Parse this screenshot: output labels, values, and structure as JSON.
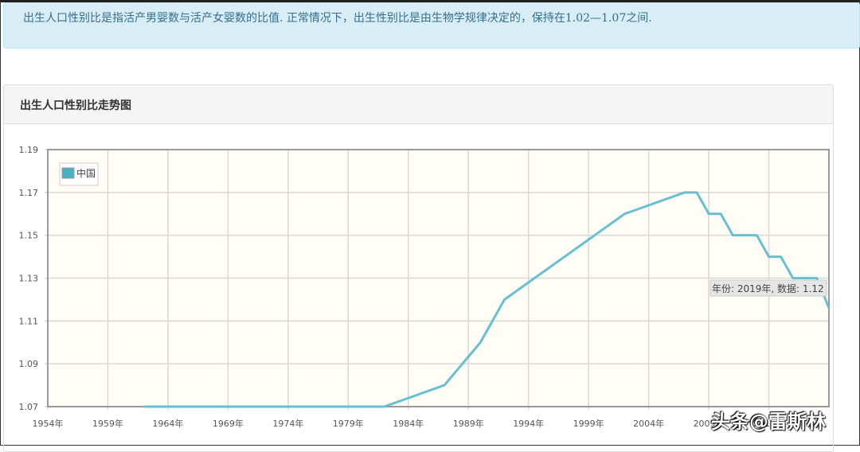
{
  "alert_text": "出生人口性别比是指活产男婴数与活产女婴数的比值. 正常情况下，出生性别比是由生物学规律决定的，保持在1.02—1.07之间.",
  "panel_title": "出生人口性别比走势图",
  "watermark": "头条@雷斯林",
  "tooltip": "年份: 2019年, 数据: 1.12",
  "colors": {
    "line": "#68bfcf",
    "plot_bg": "#fffdf6",
    "grid": "#d8d8d8"
  },
  "chart_data": {
    "type": "line",
    "title": "出生人口性别比走势图",
    "xlim": [
      1954,
      2019
    ],
    "ylim": [
      1.07,
      1.19
    ],
    "x_ticks": [
      1954,
      1959,
      1964,
      1969,
      1974,
      1979,
      1984,
      1989,
      1994,
      1999,
      2004,
      2009,
      2014
    ],
    "x_tick_labels": [
      "1954年",
      "1959年",
      "1964年",
      "1969年",
      "1974年",
      "1979年",
      "1984年",
      "1989年",
      "1994年",
      "1999年",
      "2004年",
      "2009年",
      "2014年"
    ],
    "y_ticks": [
      1.07,
      1.09,
      1.11,
      1.13,
      1.15,
      1.17,
      1.19
    ],
    "y_tick_labels": [
      "1.07",
      "1.09",
      "1.11",
      "1.13",
      "1.15",
      "1.17",
      "1.19"
    ],
    "legend": {
      "entries": [
        "中国"
      ],
      "placement": "top-left"
    },
    "grid": true,
    "series": [
      {
        "name": "中国",
        "x": [
          1962,
          1982,
          1987,
          1990,
          1992,
          2002,
          2007,
          2008,
          2009,
          2010,
          2011,
          2013,
          2014,
          2015,
          2016,
          2018,
          2019
        ],
        "y": [
          1.07,
          1.07,
          1.08,
          1.1,
          1.12,
          1.16,
          1.17,
          1.17,
          1.16,
          1.16,
          1.15,
          1.15,
          1.14,
          1.14,
          1.13,
          1.13,
          1.116
        ]
      }
    ]
  }
}
